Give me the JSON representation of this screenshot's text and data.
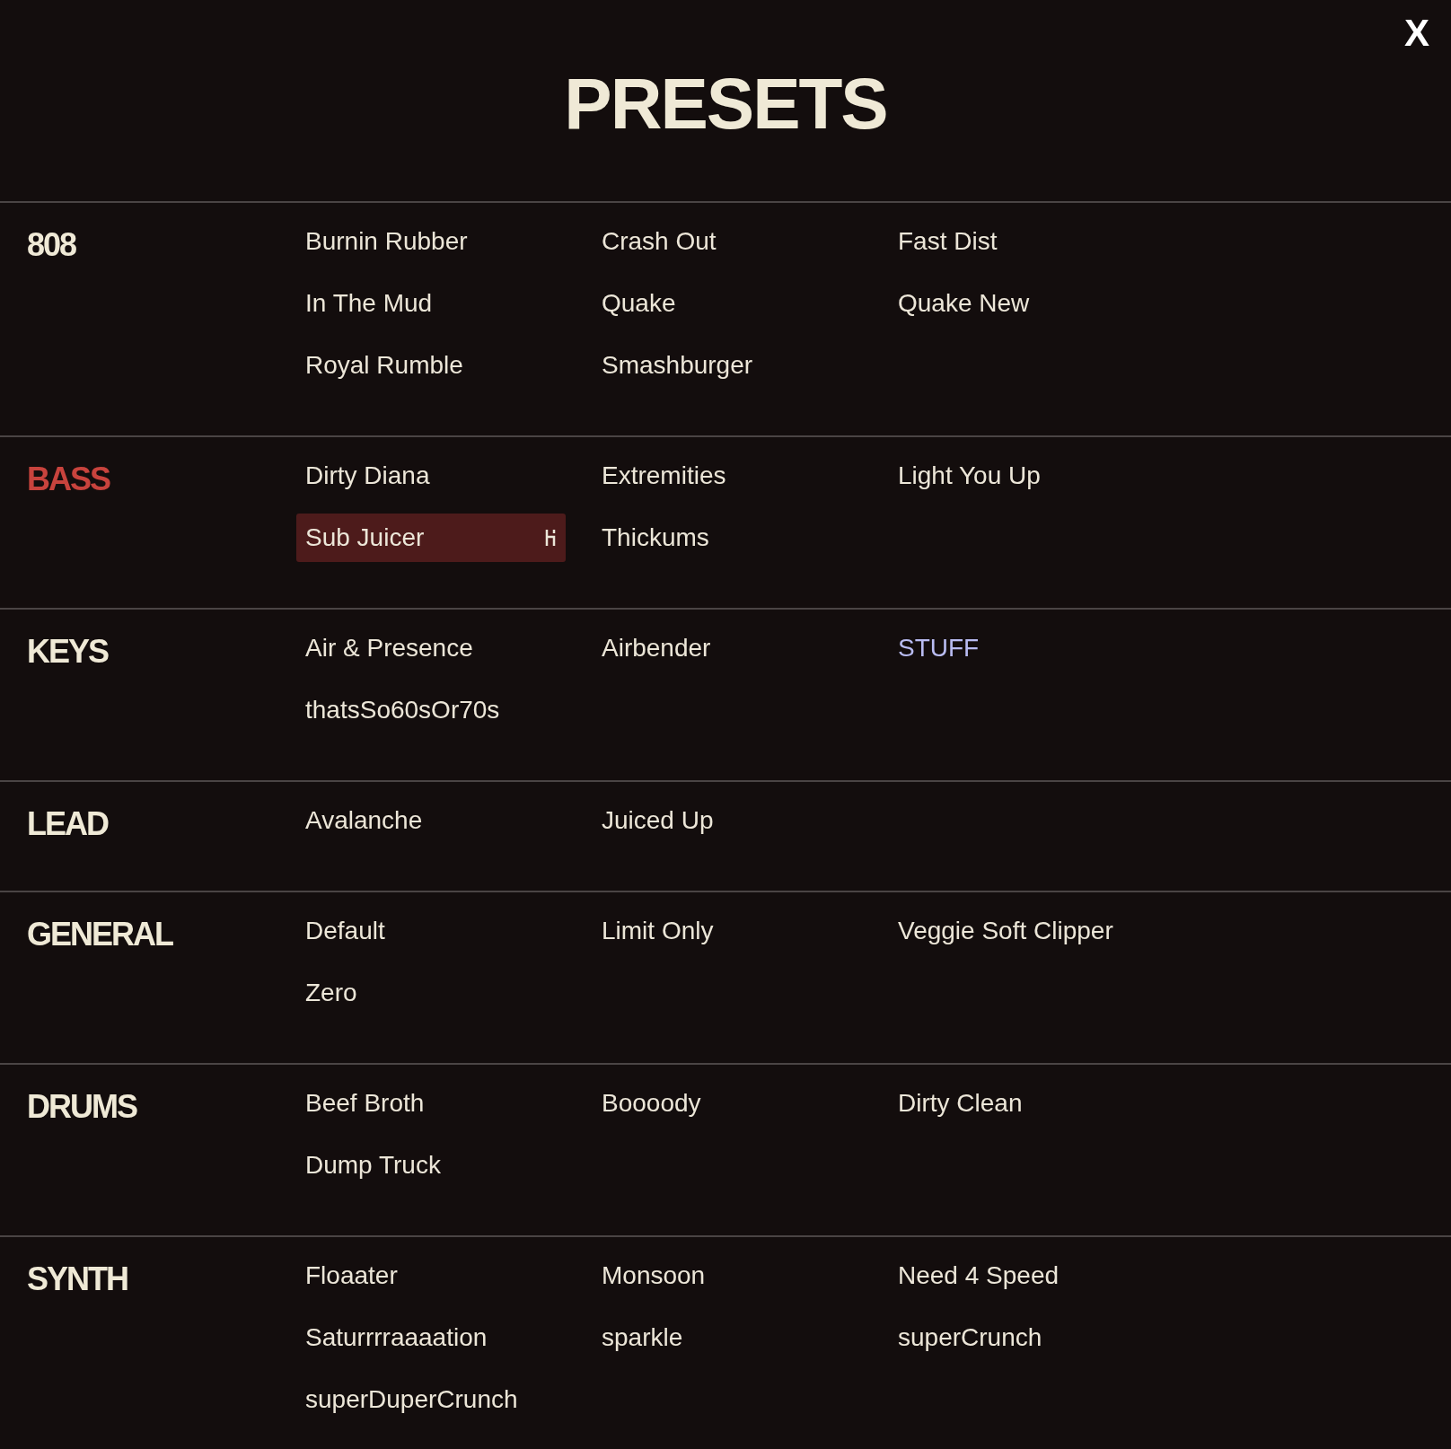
{
  "title": "PRESETS",
  "close": "X",
  "categories": [
    {
      "name": "808",
      "selected": false,
      "presets": [
        {
          "name": "Burnin Rubber",
          "selected": false,
          "kind": "factory"
        },
        {
          "name": "Crash Out",
          "selected": false,
          "kind": "factory"
        },
        {
          "name": "Fast Dist",
          "selected": false,
          "kind": "factory"
        },
        {
          "name": "In The Mud",
          "selected": false,
          "kind": "factory"
        },
        {
          "name": "Quake",
          "selected": false,
          "kind": "factory"
        },
        {
          "name": "Quake New",
          "selected": false,
          "kind": "factory"
        },
        {
          "name": "Royal Rumble",
          "selected": false,
          "kind": "factory"
        },
        {
          "name": "Smashburger",
          "selected": false,
          "kind": "factory"
        }
      ]
    },
    {
      "name": "BASS",
      "selected": true,
      "presets": [
        {
          "name": "Dirty Diana",
          "selected": false,
          "kind": "factory"
        },
        {
          "name": "Extremities",
          "selected": false,
          "kind": "factory"
        },
        {
          "name": "Light You Up",
          "selected": false,
          "kind": "factory"
        },
        {
          "name": "Sub Juicer",
          "selected": true,
          "kind": "factory"
        },
        {
          "name": "Thickums",
          "selected": false,
          "kind": "factory"
        }
      ]
    },
    {
      "name": "KEYS",
      "selected": false,
      "presets": [
        {
          "name": "Air & Presence",
          "selected": false,
          "kind": "factory"
        },
        {
          "name": "Airbender",
          "selected": false,
          "kind": "factory"
        },
        {
          "name": "STUFF",
          "selected": false,
          "kind": "user"
        },
        {
          "name": "thatsSo60sOr70s",
          "selected": false,
          "kind": "factory"
        }
      ]
    },
    {
      "name": "LEAD",
      "selected": false,
      "presets": [
        {
          "name": "Avalanche",
          "selected": false,
          "kind": "factory"
        },
        {
          "name": "Juiced Up",
          "selected": false,
          "kind": "factory"
        }
      ]
    },
    {
      "name": "GENERAL",
      "selected": false,
      "presets": [
        {
          "name": "Default",
          "selected": false,
          "kind": "factory"
        },
        {
          "name": "Limit Only",
          "selected": false,
          "kind": "factory"
        },
        {
          "name": "Veggie Soft Clipper",
          "selected": false,
          "kind": "factory"
        },
        {
          "name": "Zero",
          "selected": false,
          "kind": "factory"
        }
      ]
    },
    {
      "name": "DRUMS",
      "selected": false,
      "presets": [
        {
          "name": "Beef Broth",
          "selected": false,
          "kind": "factory"
        },
        {
          "name": "Boooody",
          "selected": false,
          "kind": "factory"
        },
        {
          "name": "Dirty Clean",
          "selected": false,
          "kind": "factory"
        },
        {
          "name": "Dump Truck",
          "selected": false,
          "kind": "factory"
        }
      ]
    },
    {
      "name": "SYNTH",
      "selected": false,
      "presets": [
        {
          "name": "Floaater",
          "selected": false,
          "kind": "factory"
        },
        {
          "name": "Monsoon",
          "selected": false,
          "kind": "factory"
        },
        {
          "name": "Need 4 Speed",
          "selected": false,
          "kind": "factory"
        },
        {
          "name": "Saturrrraaaation",
          "selected": false,
          "kind": "factory"
        },
        {
          "name": "sparkle",
          "selected": false,
          "kind": "factory"
        },
        {
          "name": "superCrunch",
          "selected": false,
          "kind": "factory"
        },
        {
          "name": "superDuperCrunch",
          "selected": false,
          "kind": "factory"
        }
      ]
    }
  ]
}
